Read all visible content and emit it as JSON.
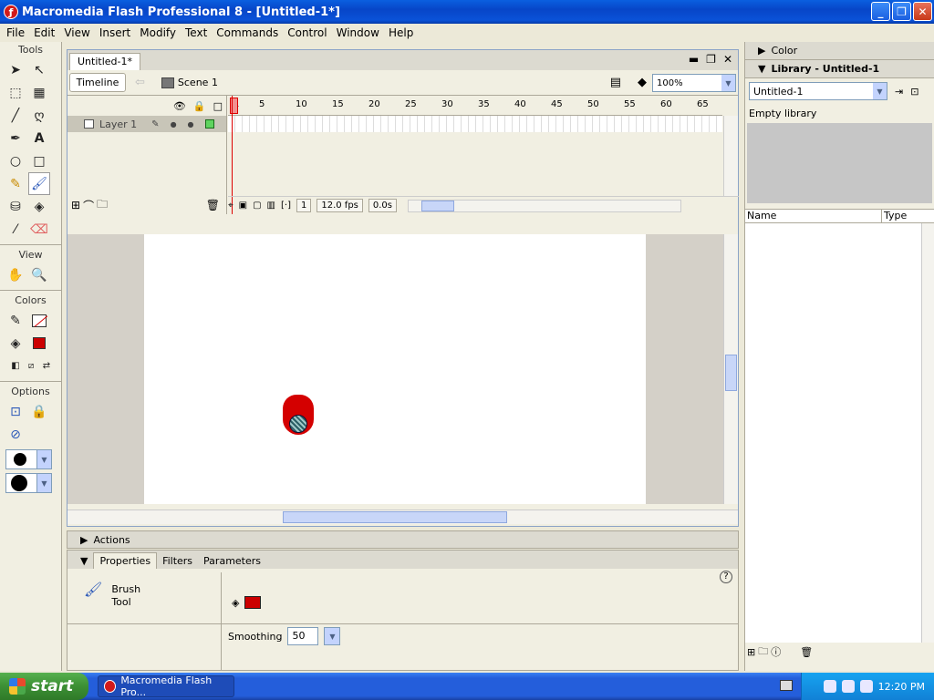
{
  "window": {
    "title": "Macromedia Flash Professional 8 - [Untitled-1*]"
  },
  "menu": [
    "File",
    "Edit",
    "View",
    "Insert",
    "Modify",
    "Text",
    "Commands",
    "Control",
    "Window",
    "Help"
  ],
  "tools": {
    "header": "Tools",
    "view_header": "View",
    "colors_header": "Colors",
    "options_header": "Options",
    "stroke_color": "#cc0000",
    "fill_color": "#cc0000"
  },
  "document": {
    "tab": "Untitled-1*",
    "timeline_button": "Timeline",
    "scene": "Scene 1",
    "zoom": "100%"
  },
  "timeline": {
    "layer_name": "Layer 1",
    "ruler": [
      "1",
      "5",
      "10",
      "15",
      "20",
      "25",
      "30",
      "35",
      "40",
      "45",
      "50",
      "55",
      "60",
      "65"
    ],
    "current_frame": "1",
    "fps": "12.0 fps",
    "time": "0.0s"
  },
  "panels": {
    "actions": "Actions",
    "tabs": [
      "Properties",
      "Filters",
      "Parameters"
    ],
    "tool_name_line1": "Brush",
    "tool_name_line2": "Tool",
    "smoothing_label": "Smoothing",
    "smoothing_value": "50"
  },
  "right": {
    "color_header": "Color",
    "library_header": "Library - Untitled-1",
    "library_select": "Untitled-1",
    "empty_label": "Empty library",
    "col_name": "Name",
    "col_type": "Type"
  },
  "taskbar": {
    "start": "start",
    "task": "Macromedia Flash Pro...",
    "clock": "12:20 PM"
  }
}
